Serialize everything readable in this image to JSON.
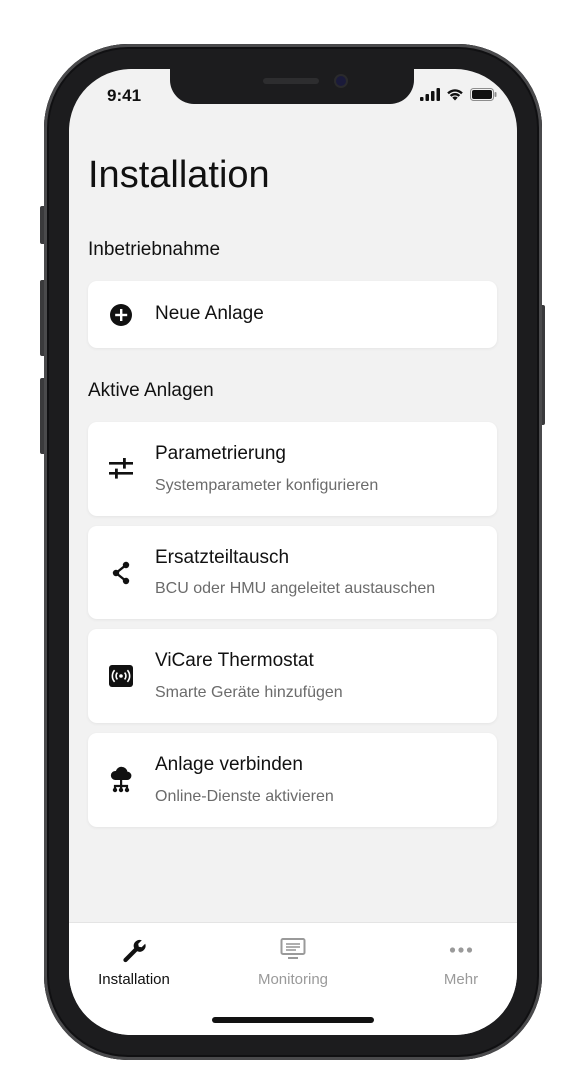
{
  "status_bar": {
    "time": "9:41"
  },
  "page": {
    "title": "Installation"
  },
  "sections": {
    "commissioning": {
      "label": "Inbetriebnahme",
      "item": {
        "title": "Neue Anlage",
        "icon": "plus-circle-icon"
      }
    },
    "active": {
      "label": "Aktive Anlagen",
      "items": [
        {
          "title": "Parametrierung",
          "subtitle": "Systemparameter konfigurieren",
          "icon": "sliders-icon"
        },
        {
          "title": "Ersatzteiltausch",
          "subtitle": "BCU oder HMU angeleitet austauschen",
          "icon": "share-nodes-icon"
        },
        {
          "title": "ViCare Thermostat",
          "subtitle": "Smarte Geräte hinzufügen",
          "icon": "signal-box-icon"
        },
        {
          "title": "Anlage verbinden",
          "subtitle": "Online-Dienste aktivieren",
          "icon": "cloud-network-icon"
        }
      ]
    }
  },
  "tabbar": {
    "tabs": [
      {
        "label": "Installation",
        "icon": "wrench-icon",
        "active": true
      },
      {
        "label": "Monitoring",
        "icon": "monitor-icon",
        "active": false
      },
      {
        "label": "Mehr",
        "icon": "more-dots-icon",
        "active": false
      }
    ]
  },
  "colors": {
    "screen_bg": "#f2f2f2",
    "card_bg": "#ffffff",
    "active_tab": "#111111",
    "inactive_tab": "#9a9a9a"
  }
}
